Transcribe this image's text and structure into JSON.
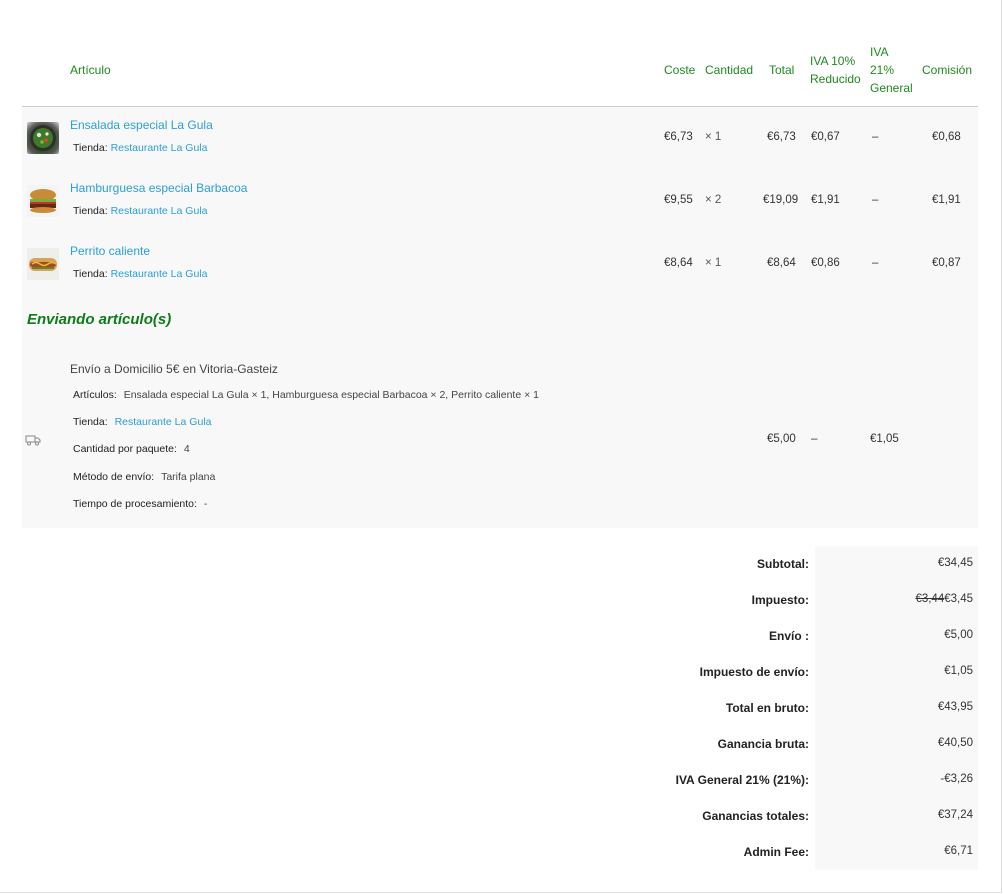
{
  "headers": {
    "item": "Artículo",
    "cost": "Coste",
    "qty": "Cantidad",
    "total": "Total",
    "iva10_l1": "IVA 10%",
    "iva10_l2": "Reducido",
    "iva21_l1": "IVA",
    "iva21_l2": "21%",
    "iva21_l3": "General",
    "commission": "Comisión"
  },
  "items": [
    {
      "name": "Ensalada especial La Gula",
      "shop_label": "Tienda:",
      "shop": "Restaurante La Gula",
      "cost": "€6,73",
      "qty": "× 1",
      "total": "€6,73",
      "iva10": "€0,67",
      "iva21": "–",
      "commission": "€0,68",
      "thumb": "salad"
    },
    {
      "name": "Hamburguesa especial Barbacoa",
      "shop_label": "Tienda:",
      "shop": "Restaurante La Gula",
      "cost": "€9,55",
      "qty": "× 2",
      "total": "€19,09",
      "iva10": "€1,91",
      "iva21": "–",
      "commission": "€1,91",
      "thumb": "burger"
    },
    {
      "name": "Perrito caliente",
      "shop_label": "Tienda:",
      "shop": "Restaurante La Gula",
      "cost": "€8,64",
      "qty": "× 1",
      "total": "€8,64",
      "iva10": "€0,86",
      "iva21": "–",
      "commission": "€0,87",
      "thumb": "hotdog"
    }
  ],
  "shipping": {
    "section_title": "Enviando artículo(s)",
    "icon": "truck-icon",
    "method_name": "Envío a Domicilio 5€ en Vitoria-Gasteiz",
    "articles_label": "Artículos:",
    "articles_value": "Ensalada especial La Gula × 1, Hamburguesa especial Barbacoa × 2, Perrito caliente × 1",
    "shop_label": "Tienda:",
    "shop_value": "Restaurante La Gula",
    "package_qty_label": "Cantidad por paquete:",
    "package_qty_value": "4",
    "ship_method_label": "Método de envío:",
    "ship_method_value": "Tarifa plana",
    "processing_label": "Tiempo de procesamiento:",
    "processing_value": "-",
    "total": "€5,00",
    "iva10": "–",
    "iva21": "€1,05"
  },
  "totals": [
    {
      "label": "Subtotal:",
      "value": "€34,45"
    },
    {
      "label": "Impuesto:",
      "old": "€3,44",
      "value": "€3,45"
    },
    {
      "label": "Envío :",
      "value": "€5,00"
    },
    {
      "label": "Impuesto de envío:",
      "value": "€1,05"
    },
    {
      "label": "Total en bruto:",
      "value": "€43,95"
    },
    {
      "label": "Ganancia bruta:",
      "value": "€40,50"
    },
    {
      "label": "IVA General 21% (21%):",
      "value": "-€3,26"
    },
    {
      "label": "Ganancias totales:",
      "value": "€37,24"
    },
    {
      "label": "Admin Fee:",
      "value": "€6,71"
    }
  ],
  "colors": {
    "header_green": "#1e8a1e",
    "link_blue": "#2a9fd6",
    "section_green": "#0d7d1a"
  }
}
